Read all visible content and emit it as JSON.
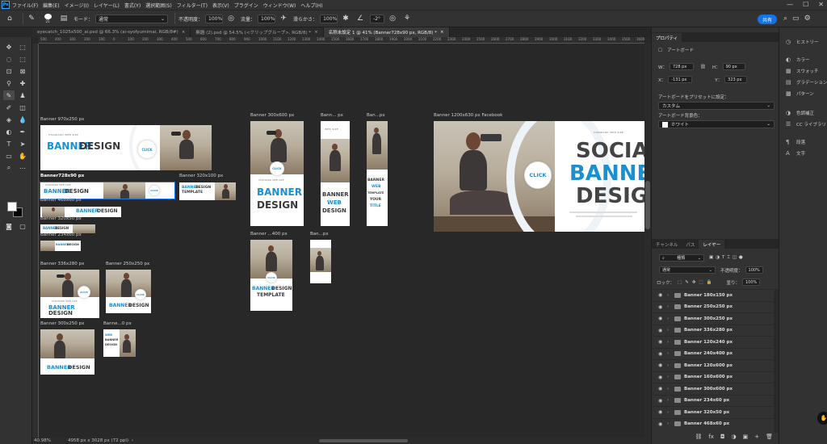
{
  "menubar": {
    "logo": "Ps",
    "items": [
      "ファイル(F)",
      "編集(E)",
      "イメージ(I)",
      "レイヤー(L)",
      "書式(Y)",
      "選択範囲(S)",
      "フィルター(T)",
      "表示(V)",
      "プラグイン",
      "ウィンドウ(W)",
      "ヘルプ(H)"
    ],
    "window_controls": [
      "—",
      "☐",
      "✕"
    ]
  },
  "options": {
    "brush_size": "25",
    "mode_label": "モード：",
    "mode_value": "通常",
    "opacity_label": "不透明度：",
    "opacity_value": "100%",
    "flow_label": "流量：",
    "flow_value": "100%",
    "smoothing_label": "滑らかさ：",
    "smoothing_value": "100%",
    "angle_value": "-2°",
    "share_label": "共有"
  },
  "tabs": [
    {
      "label": "eyecatch_1025x500_ai.psd @ 66.3% (ai-syofyumimai, RGB/8#)",
      "active": false
    },
    {
      "label": "無題 (2).psd @ 54.5% (<クリップグループ>, RGB/8) *",
      "active": false
    },
    {
      "label": "名称未設定 1 @ 41% (Banner728x90 px, RGB/8) *",
      "active": true
    }
  ],
  "ruler_ticks": [
    "500",
    "400",
    "300",
    "200",
    "100",
    "0",
    "100",
    "200",
    "300",
    "400",
    "500",
    "600",
    "700",
    "800",
    "900",
    "1000",
    "1100",
    "1200",
    "1300",
    "1400",
    "1500",
    "1600",
    "1700",
    "1800",
    "1900",
    "2000",
    "2100",
    "2200",
    "2300",
    "2400",
    "2500",
    "2600",
    "2700",
    "2800",
    "2900",
    "3000",
    "3100",
    "3200",
    "3300",
    "3400",
    "3500",
    "3600"
  ],
  "artboards": {
    "b970": {
      "label": "Banner 970x250 px",
      "small": "STANDARD WEB SIZE",
      "blue": "BANNER",
      "dark": "DESIGN",
      "click": "CLICK"
    },
    "b728": {
      "label": "Banner728x90 px",
      "small": "STANDARD WEB SIZE",
      "blue": "BANNER",
      "dark": "DESIGN",
      "click": "CLICK"
    },
    "b468": {
      "label": "Banner 468x60 px",
      "blue": "BANNER",
      "dark": "DESIGN"
    },
    "b320x100": {
      "label": "Banner 320x100 px",
      "blue": "BANNER",
      "dark": "DESIGN",
      "sub": "TEMPLATE"
    },
    "b320x50": {
      "label": "Banner 320x50 px",
      "blue": "BANNER",
      "dark": "DESIGN"
    },
    "b234": {
      "label": "Banner 234x60 px",
      "blue": "BANNER",
      "dark": "DESIGN"
    },
    "b336": {
      "label": "Banner 336x280 px",
      "small": "STANDARD WEB SIZE",
      "blue": "BANNER",
      "dark": "DESIGN",
      "click": "CLICK"
    },
    "b250": {
      "label": "Banner 250x250 px",
      "blue": "BANNER",
      "dark": "DESIGN",
      "click": "CLICK"
    },
    "b300x250": {
      "label": "Banner 300x250 px",
      "blue": "BANNER",
      "dark": "DESIGN"
    },
    "b200": {
      "label": "Banne...0 px",
      "blue": "WEB",
      "dark": "BANNER",
      "sub": "DESIGN"
    },
    "b300x600": {
      "label": "Banner 300x600 px",
      "small": "STANDARD WEB SIZE",
      "blue": "BANNER",
      "dark": "DESIGN",
      "click": "CLICK"
    },
    "b160": {
      "label": "Bann... px",
      "small": "WEB SIZE",
      "dark1": "BANNER",
      "blue": "WEB",
      "dark2": "DESIGN"
    },
    "b120": {
      "label": "Ban...px",
      "dark1": "BANNER",
      "blue": "WEB",
      "dark2": "TEMPLATE",
      "dark3": "YOUR",
      "blue2": "TITLE"
    },
    "b240": {
      "label": "Banner ...400 px",
      "blue": "BANNER",
      "dark": "DESIGN",
      "sub": "TEMPLATE",
      "click": "CLICK"
    },
    "b120x240": {
      "label": "Ban...px"
    },
    "facebook": {
      "label": "Banner 1200x630 px Facebook",
      "small": "STANDARD WEB SIZE",
      "line1": "SOCIAL",
      "line2": "BANNER",
      "line3": "DESIGN",
      "click": "CLICK"
    }
  },
  "status": {
    "zoom": "40.98%",
    "doc_info": "4958 px x 3028 px (72 ppi)"
  },
  "properties": {
    "tab": "プロパティ",
    "artboard_label": "アートボード",
    "w_label": "W：",
    "w_value": "728 px",
    "h_label": "H：",
    "h_value": "90 px",
    "x_label": "X：",
    "x_value": "-131 px",
    "y_label": "Y：",
    "y_value": "323 px",
    "preset_label": "アートボードをプリセットに設定：",
    "preset_value": "カスタム",
    "bg_label": "アートボード背景色：",
    "bg_value": "ホワイト"
  },
  "layers_panel": {
    "tabs": [
      "チャンネル",
      "パス",
      "レイヤー"
    ],
    "filter_label": "種類",
    "blend_mode": "通常",
    "opacity_label": "不透明度：",
    "opacity_value": "100%",
    "lock_label": "ロック：",
    "fill_label": "塗り：",
    "fill_value": "100%",
    "layers": [
      "Banner 180x150 px",
      "Banner 250x250 px",
      "Banner 300x250 px",
      "Banner 336x280 px",
      "Banner 120x240 px",
      "Banner 240x400 px",
      "Banner 120x600 px",
      "Banner 160x600 px",
      "Banner 300x600 px",
      "Banner 234x60 px",
      "Banner 320x50 px",
      "Banner 468x60 px"
    ],
    "footer_icons": [
      "fx",
      "◘",
      "◑",
      "▣",
      "+",
      "🗑"
    ]
  },
  "side_panels": [
    {
      "label": "ヒストリー",
      "icon": "clock-icon"
    },
    {
      "label": "カラー",
      "icon": "palette-icon"
    },
    {
      "label": "スウォッチ",
      "icon": "grid-icon"
    },
    {
      "label": "グラデーション",
      "icon": "gradient-icon"
    },
    {
      "label": "パターン",
      "icon": "pattern-icon"
    },
    {
      "label": "色調補正",
      "icon": "adjust-icon"
    },
    {
      "label": "CC ライブラリ",
      "icon": "library-icon"
    },
    {
      "label": "段落",
      "icon": "paragraph-icon"
    },
    {
      "label": "文字",
      "icon": "type-icon"
    }
  ]
}
